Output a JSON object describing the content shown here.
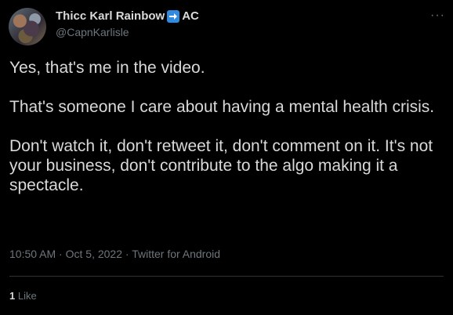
{
  "tweet": {
    "author": {
      "display_name": "Thicc Karl Rainbow",
      "name_emoji_icon": "right-arrow-emoji-icon",
      "name_suffix": "AC",
      "handle": "@CapnKarlisle",
      "avatar": "avatar-photo"
    },
    "more_icon": "more-options-icon",
    "more_glyph": "···",
    "paragraphs": [
      "Yes, that's me in the video.",
      "That's someone I care about having a mental health crisis.",
      "Don't watch it, don't retweet it, don't comment on it. It's not your business, don't contribute to the algo making it a spectacle."
    ],
    "meta": {
      "time": "10:50 AM",
      "sep1": " · ",
      "date": "Oct 5, 2022",
      "sep2": " · ",
      "source": "Twitter for Android"
    },
    "stats": {
      "likes_count": "1",
      "likes_label": "Like"
    }
  },
  "colors": {
    "background": "#000000",
    "text_primary": "#d9d9d9",
    "text_secondary": "#6e767d",
    "divider": "#2f3336",
    "emoji_blue": "#2e8be0"
  }
}
